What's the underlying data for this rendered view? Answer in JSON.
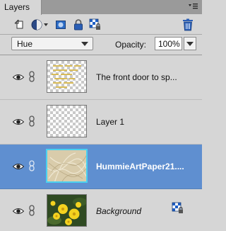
{
  "panel": {
    "tab_title": "Layers"
  },
  "toolbar": {
    "icons": [
      "new-layer-icon",
      "adjustment-layer-icon",
      "layer-mask-icon",
      "lock-all-icon",
      "lock-transparency-icon",
      "trash-icon"
    ]
  },
  "blend": {
    "mode": "Hue",
    "opacity_label": "Opacity:",
    "opacity_value": "100%"
  },
  "layers": [
    {
      "name": "The front door to sp...",
      "thumb": "text-on-transparent",
      "selected": false
    },
    {
      "name": "Layer 1",
      "thumb": "transparent",
      "selected": false
    },
    {
      "name": "HummieArtPaper21....",
      "thumb": "paper-texture",
      "selected": true
    },
    {
      "name": "Background",
      "thumb": "yellow-flowers",
      "selected": false,
      "locked": true
    }
  ],
  "colors": {
    "panel_bg": "#d6d6d6",
    "selected_row": "#5f8fd0",
    "selected_thumb_border": "#4ad1f0"
  }
}
